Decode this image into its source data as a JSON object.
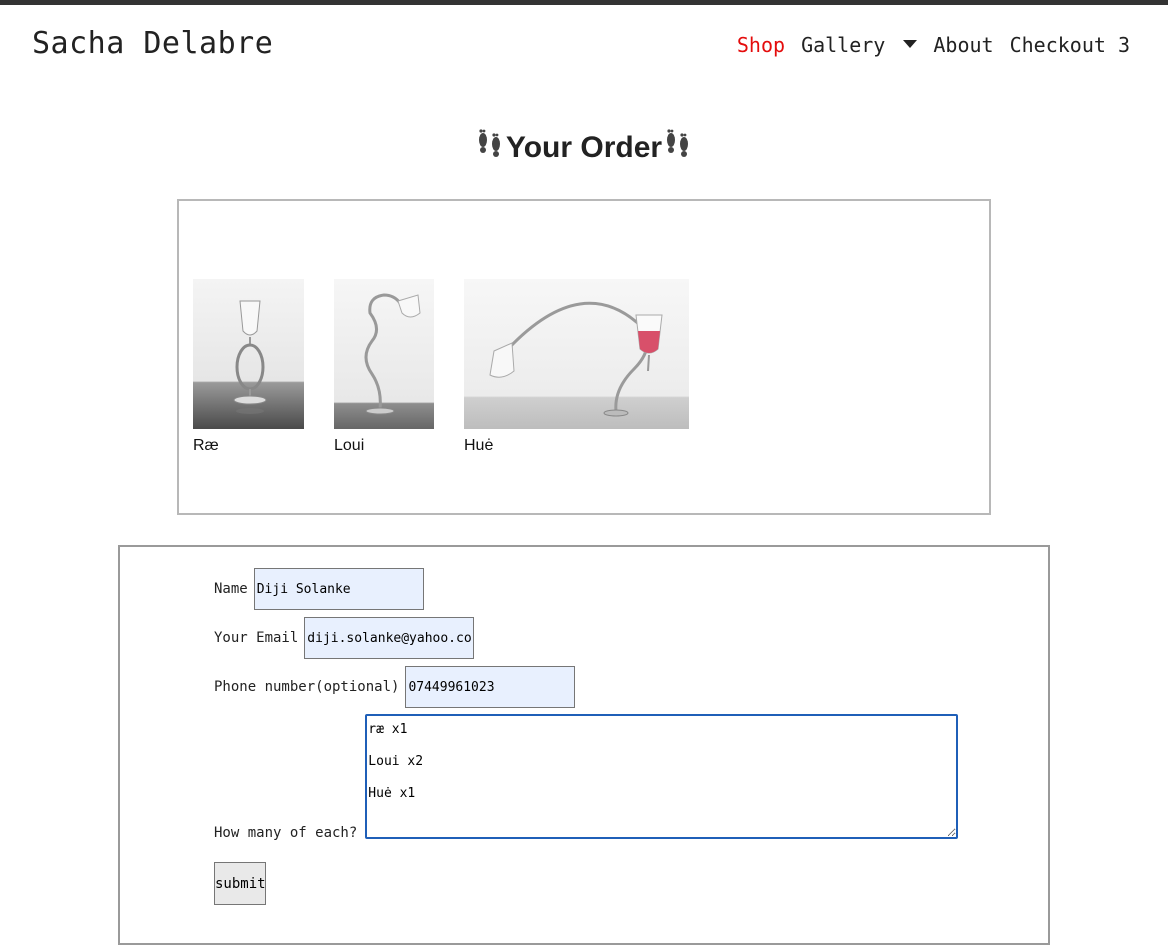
{
  "site": {
    "brand": "Sacha Delabre"
  },
  "nav": {
    "shop": "Shop",
    "gallery": "Gallery",
    "about": "About",
    "checkout": "Checkout 3",
    "active_color": "#e40c0c"
  },
  "page": {
    "heading": "Your Order",
    "heading_icon": "footprints-icon"
  },
  "order_items": [
    {
      "name": "Ræ"
    },
    {
      "name": "Loui"
    },
    {
      "name": "Huė"
    }
  ],
  "form": {
    "name_label": "Name",
    "name_value": "Diji Solanke",
    "email_label": "Your Email",
    "email_value": "diji.solanke@yahoo.com",
    "phone_label": "Phone number(optional)",
    "phone_value": "07449961023",
    "quantity_label": "How many of each?",
    "quantity_value": "ræ x1\n\nLoui x2\n\nHuė x1",
    "submit_label": "submit"
  }
}
